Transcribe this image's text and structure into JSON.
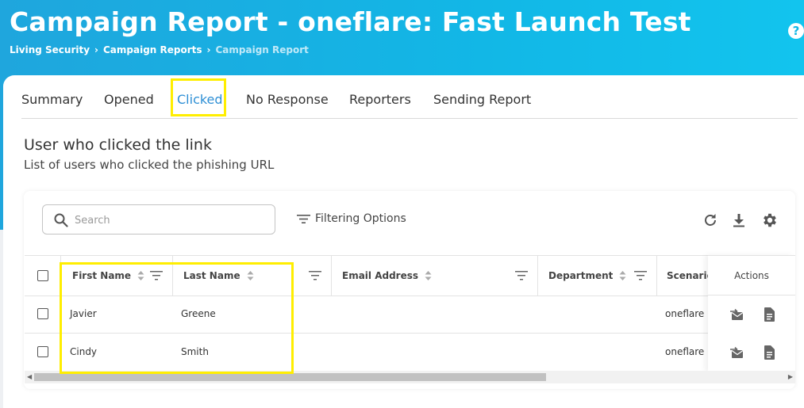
{
  "page": {
    "title": "Campaign Report - oneflare: Fast Launch Test",
    "breadcrumb": [
      "Living Security",
      "Campaign Reports",
      "Campaign Report"
    ],
    "breadcrumb_separator": "›",
    "help_label": "?"
  },
  "tabs": [
    {
      "label": "Summary",
      "active": false
    },
    {
      "label": "Opened",
      "active": false
    },
    {
      "label": "Clicked",
      "active": true
    },
    {
      "label": "No Response",
      "active": false
    },
    {
      "label": "Reporters",
      "active": false
    },
    {
      "label": "Sending Report",
      "active": false
    }
  ],
  "section": {
    "title": "User who clicked the link",
    "subtitle": "List of users who clicked the phishing URL"
  },
  "toolbar": {
    "search_placeholder": "Search",
    "search_value": "",
    "filter_label": "Filtering Options",
    "icons": [
      "refresh-icon",
      "download-icon",
      "settings-gear-icon"
    ]
  },
  "table": {
    "columns": [
      "First Name",
      "Last Name",
      "Email Address",
      "Department",
      "Scenario",
      "Actions"
    ],
    "rows": [
      {
        "first_name": "Javier",
        "last_name": "Greene",
        "email": "",
        "department": "",
        "scenario": "oneflare"
      },
      {
        "first_name": "Cindy",
        "last_name": "Smith",
        "email": "",
        "department": "",
        "scenario": "oneflare"
      }
    ],
    "row_action_icons": [
      "resend-email-icon",
      "document-icon"
    ]
  },
  "colors": {
    "header_gradient_start": "#1fa6dd",
    "header_gradient_end": "#12c4ee",
    "active_tab": "#2d8fd5",
    "highlight": "#ffee00"
  }
}
